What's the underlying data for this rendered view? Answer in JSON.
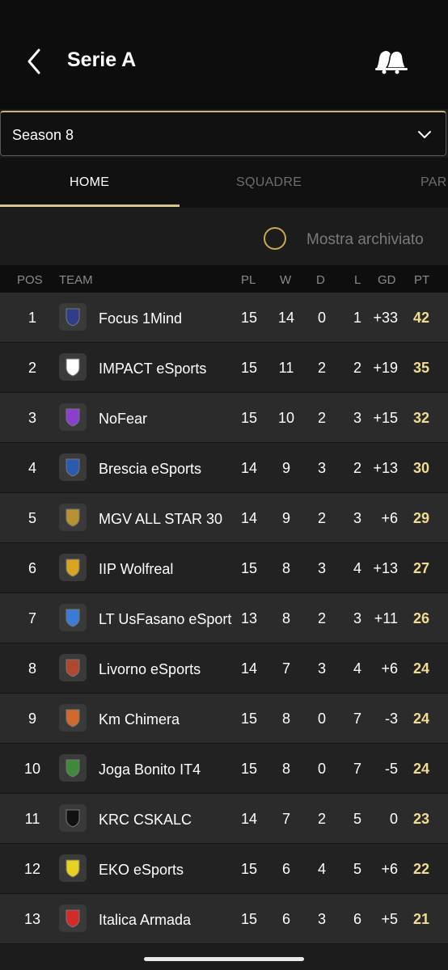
{
  "header": {
    "title": "Serie A"
  },
  "season": {
    "value": "Season 8"
  },
  "tabs": [
    {
      "label": "HOME"
    },
    {
      "label": "SQUADRE"
    },
    {
      "label": "PAR"
    }
  ],
  "archive": {
    "label": "Mostra archiviato"
  },
  "table": {
    "columns": {
      "pos": "POS",
      "team": "TEAM",
      "pl": "PL",
      "w": "W",
      "d": "D",
      "l": "L",
      "gd": "GD",
      "pt": "PT"
    },
    "rows": [
      {
        "pos": "1",
        "team": "Focus 1Mind",
        "pl": "15",
        "w": "14",
        "d": "0",
        "l": "1",
        "gd": "+33",
        "pt": "42",
        "logo": "focus-logo-icon",
        "color": "#2c3e8a"
      },
      {
        "pos": "2",
        "team": "IMPACT eSports",
        "pl": "15",
        "w": "11",
        "d": "2",
        "l": "2",
        "gd": "+19",
        "pt": "35",
        "logo": "impact-logo-icon",
        "color": "#ffffff"
      },
      {
        "pos": "3",
        "team": "NoFear",
        "pl": "15",
        "w": "10",
        "d": "2",
        "l": "3",
        "gd": "+15",
        "pt": "32",
        "logo": "nofear-logo-icon",
        "color": "#8a3fd0"
      },
      {
        "pos": "4",
        "team": "Brescia eSports",
        "pl": "14",
        "w": "9",
        "d": "3",
        "l": "2",
        "gd": "+13",
        "pt": "30",
        "logo": "brescia-logo-icon",
        "color": "#2a5bb0"
      },
      {
        "pos": "5",
        "team": "MGV ALL STAR 30",
        "pl": "14",
        "w": "9",
        "d": "2",
        "l": "3",
        "gd": "+6",
        "pt": "29",
        "logo": "allstar-logo-icon",
        "color": "#b8922e"
      },
      {
        "pos": "6",
        "team": "IIP Wolfreal",
        "pl": "15",
        "w": "8",
        "d": "3",
        "l": "4",
        "gd": "+13",
        "pt": "27",
        "logo": "wolf-logo-icon",
        "color": "#d9a520"
      },
      {
        "pos": "7",
        "team": "LT UsFasano eSport",
        "pl": "13",
        "w": "8",
        "d": "2",
        "l": "3",
        "gd": "+11",
        "pt": "26",
        "logo": "fasano-logo-icon",
        "color": "#3a7bd5"
      },
      {
        "pos": "8",
        "team": "Livorno eSports",
        "pl": "14",
        "w": "7",
        "d": "3",
        "l": "4",
        "gd": "+6",
        "pt": "24",
        "logo": "livorno-logo-icon",
        "color": "#b0472e"
      },
      {
        "pos": "9",
        "team": "Km Chimera",
        "pl": "15",
        "w": "8",
        "d": "0",
        "l": "7",
        "gd": "-3",
        "pt": "24",
        "logo": "chimera-logo-icon",
        "color": "#d06a2a"
      },
      {
        "pos": "10",
        "team": "Joga Bonito IT4",
        "pl": "15",
        "w": "8",
        "d": "0",
        "l": "7",
        "gd": "-5",
        "pt": "24",
        "logo": "joga-logo-icon",
        "color": "#3f8a3a"
      },
      {
        "pos": "11",
        "team": "KRC CSKALC",
        "pl": "14",
        "w": "7",
        "d": "2",
        "l": "5",
        "gd": "0",
        "pt": "23",
        "logo": "krc-logo-icon",
        "color": "#111111"
      },
      {
        "pos": "12",
        "team": "EKO eSports",
        "pl": "15",
        "w": "6",
        "d": "4",
        "l": "5",
        "gd": "+6",
        "pt": "22",
        "logo": "eko-logo-icon",
        "color": "#e6d21f"
      },
      {
        "pos": "13",
        "team": "Italica Armada",
        "pl": "15",
        "w": "6",
        "d": "3",
        "l": "6",
        "gd": "+5",
        "pt": "21",
        "logo": "italica-logo-icon",
        "color": "#d32a2a"
      }
    ]
  }
}
